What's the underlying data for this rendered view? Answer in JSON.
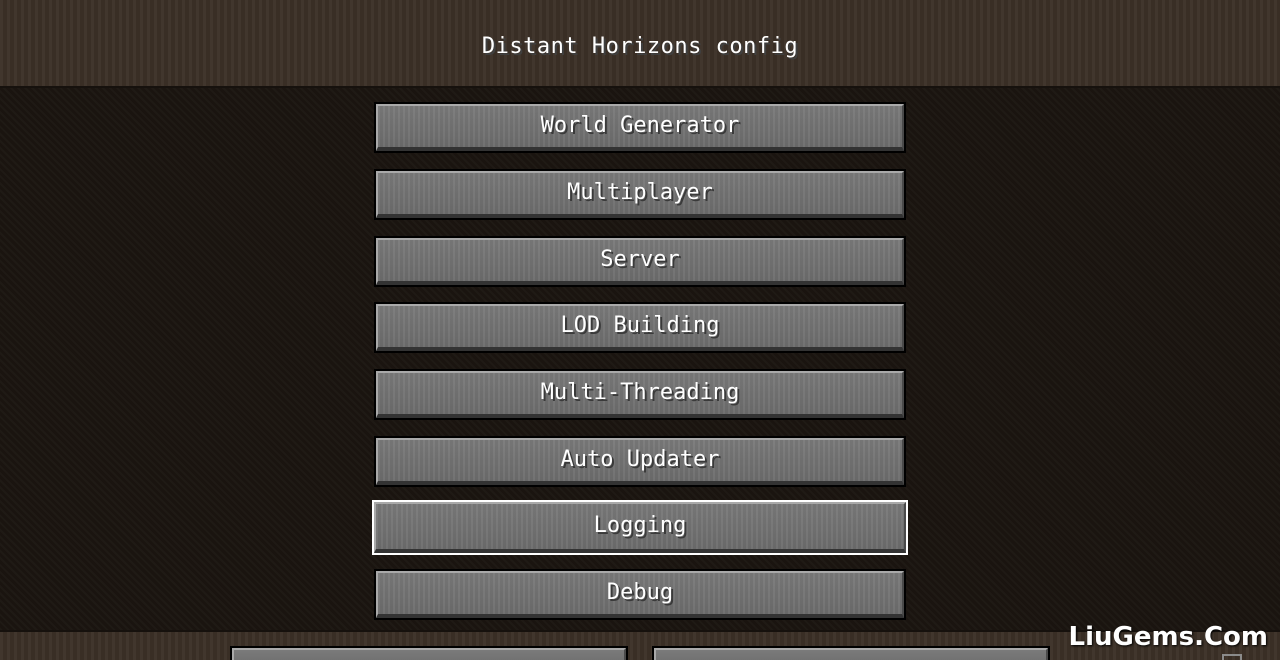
{
  "title": "Distant Horizons config",
  "menu": {
    "buttons": [
      {
        "label": "World Generator"
      },
      {
        "label": "Multiplayer"
      },
      {
        "label": "Server"
      },
      {
        "label": "LOD Building"
      },
      {
        "label": "Multi-Threading"
      },
      {
        "label": "Auto Updater"
      },
      {
        "label": "Logging"
      },
      {
        "label": "Debug"
      }
    ],
    "selected": "Logging"
  },
  "watermark": "LiuGems.Com",
  "colors": {
    "button_face": "#707070",
    "button_text": "#ffffff",
    "selected_outline": "#ffffff",
    "background": "#1b1510"
  }
}
